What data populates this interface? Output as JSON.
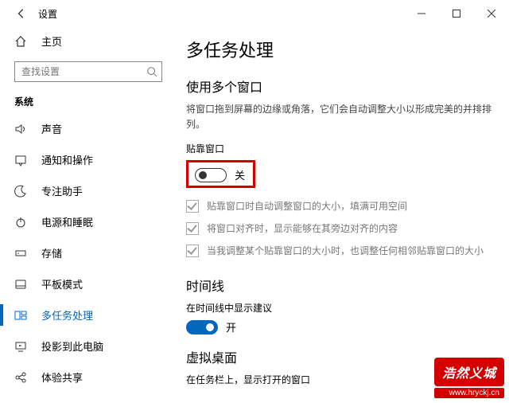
{
  "window": {
    "title": "设置"
  },
  "sidebar": {
    "home": "主页",
    "search_placeholder": "查找设置",
    "group": "系统",
    "items": [
      {
        "label": "声音"
      },
      {
        "label": "通知和操作"
      },
      {
        "label": "专注助手"
      },
      {
        "label": "电源和睡眠"
      },
      {
        "label": "存储"
      },
      {
        "label": "平板模式"
      },
      {
        "label": "多任务处理"
      },
      {
        "label": "投影到此电脑"
      },
      {
        "label": "体验共享"
      }
    ]
  },
  "main": {
    "title": "多任务处理",
    "section1_heading": "使用多个窗口",
    "section1_desc": "将窗口拖到屏幕的边缘或角落，它们会自动调整大小以形成完美的并排排列。",
    "snap_label": "贴靠窗口",
    "snap_state": "关",
    "checks": [
      "贴靠窗口时自动调整窗口的大小，填满可用空间",
      "将窗口对齐时，显示能够在其旁边对齐的内容",
      "当我调整某个贴靠窗口的大小时，也调整任何相邻贴靠窗口的大小"
    ],
    "section2_heading": "时间线",
    "timeline_label": "在时间线中显示建议",
    "timeline_state": "开",
    "section3_heading": "虚拟桌面",
    "vd_label": "在任务栏上，显示打开的窗口"
  },
  "watermark": {
    "text": "浩然义城",
    "url": "www.hryckj.cn"
  }
}
